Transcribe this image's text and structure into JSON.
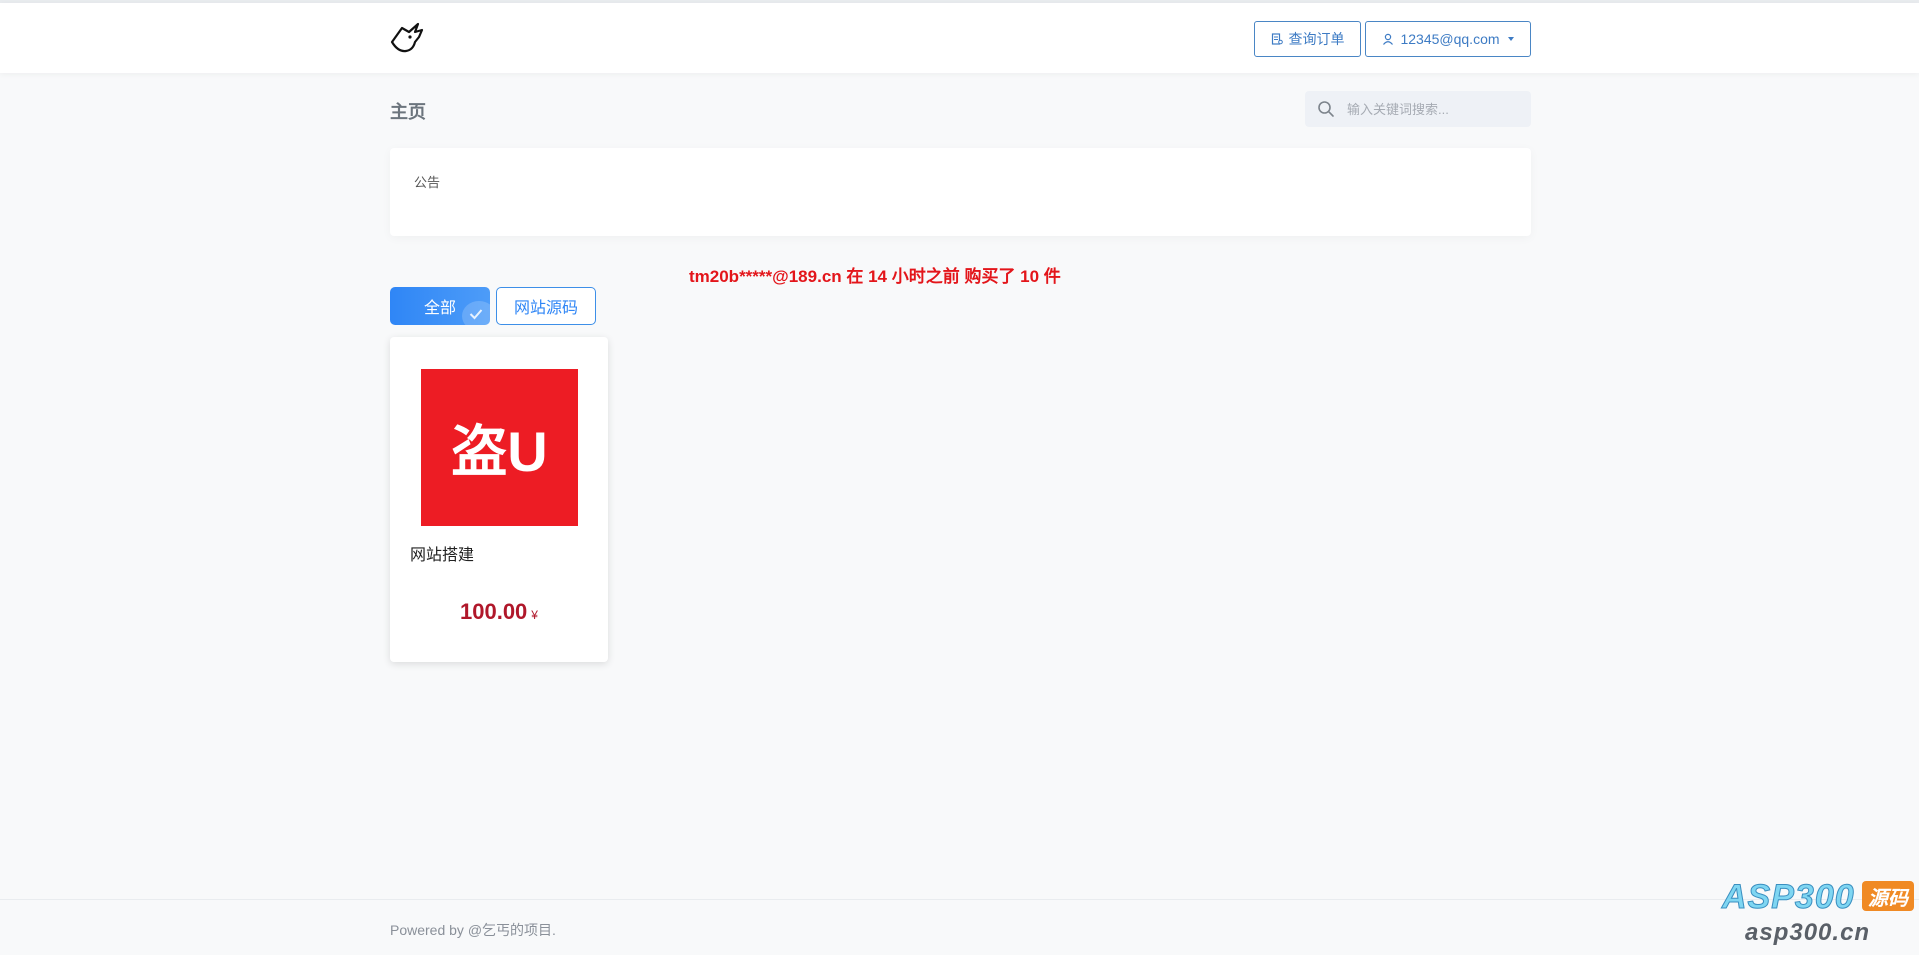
{
  "header": {
    "logo_icon": "horned-cat-logo-icon",
    "orders_button": {
      "label": "查询订单",
      "icon": "receipt-icon"
    },
    "user_button": {
      "label": "12345@qq.com",
      "icon": "user-icon"
    }
  },
  "page": {
    "title": "主页"
  },
  "search": {
    "placeholder": "输入关键词搜索...",
    "value": ""
  },
  "notice": {
    "label": "公告"
  },
  "ticker": {
    "text": "tm20b*****@189.cn 在 14 小时之前 购买了 10 件"
  },
  "tabs": [
    {
      "label": "全部",
      "active": true
    },
    {
      "label": "网站源码",
      "active": false
    }
  ],
  "products": [
    {
      "image_text": "盗U",
      "image_color": "#ED1C24",
      "name": "网站搭建",
      "price": "100.00",
      "currency": "¥"
    }
  ],
  "footer": {
    "text": "Powered by @乞丐的项目."
  },
  "watermark": {
    "brand": "ASP300",
    "badge": "源码",
    "domain": "asp300.cn"
  },
  "colors": {
    "accent": "#2F86F6",
    "price": "#B0172A",
    "ticker": "#E3151A"
  }
}
